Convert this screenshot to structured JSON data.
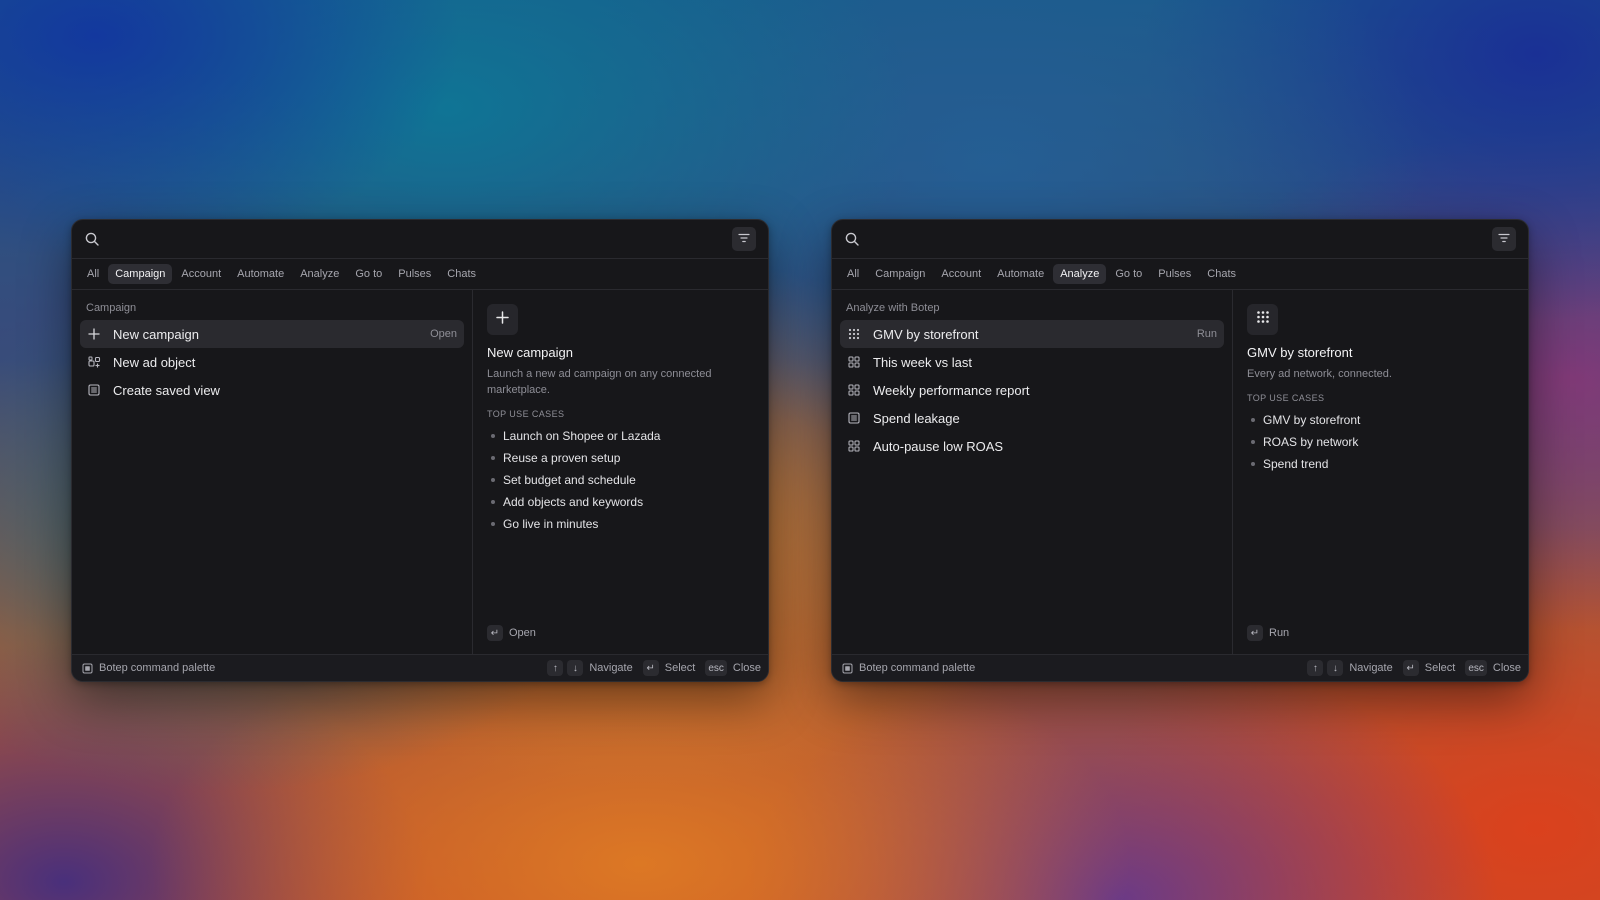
{
  "palettes": [
    {
      "search": {
        "placeholder": ""
      },
      "tabs": [
        "All",
        "Campaign",
        "Account",
        "Automate",
        "Analyze",
        "Go to",
        "Pulses",
        "Chats"
      ],
      "active_tab": "Campaign",
      "section_label": "Campaign",
      "items": [
        {
          "icon": "plus-icon",
          "label": "New campaign",
          "action": "Open"
        },
        {
          "icon": "ad-object-icon",
          "label": "New ad object",
          "action": ""
        },
        {
          "icon": "saved-view-icon",
          "label": "Create saved view",
          "action": ""
        }
      ],
      "detail": {
        "icon": "plus-icon",
        "title": "New campaign",
        "description": "Launch a new ad campaign on any connected marketplace.",
        "uses_label": "TOP USE CASES",
        "uses": [
          "Launch on Shopee or Lazada",
          "Reuse a proven setup",
          "Set budget and schedule",
          "Add objects and keywords",
          "Go live in minutes"
        ],
        "action_key": "↵",
        "action_label": "Open"
      },
      "footer": {
        "brand": "Botep command palette",
        "up_key": "↑",
        "down_key": "↓",
        "navigate": "Navigate",
        "select_key": "↵",
        "select": "Select",
        "close_key": "esc",
        "close": "Close"
      }
    },
    {
      "search": {
        "placeholder": ""
      },
      "tabs": [
        "All",
        "Campaign",
        "Account",
        "Automate",
        "Analyze",
        "Go to",
        "Pulses",
        "Chats"
      ],
      "active_tab": "Analyze",
      "section_label": "Analyze with Botep",
      "items": [
        {
          "icon": "grid-dots-icon",
          "label": "GMV by storefront",
          "action": "Run"
        },
        {
          "icon": "grid-squares-icon",
          "label": "This week vs last",
          "action": ""
        },
        {
          "icon": "grid-squares-icon",
          "label": "Weekly performance report",
          "action": ""
        },
        {
          "icon": "report-icon",
          "label": "Spend leakage",
          "action": ""
        },
        {
          "icon": "grid-squares-icon",
          "label": "Auto-pause low ROAS",
          "action": ""
        }
      ],
      "detail": {
        "icon": "grid-dots-icon",
        "title": "GMV by storefront",
        "description": "Every ad network, connected.",
        "uses_label": "TOP USE CASES",
        "uses": [
          "GMV by storefront",
          "ROAS by network",
          "Spend trend"
        ],
        "action_key": "↵",
        "action_label": "Run"
      },
      "footer": {
        "brand": "Botep command palette",
        "up_key": "↑",
        "down_key": "↓",
        "navigate": "Navigate",
        "select_key": "↵",
        "select": "Select",
        "close_key": "esc",
        "close": "Close"
      }
    }
  ],
  "colors": {
    "panel": "#17171a",
    "selected": "#2a2a2f",
    "text": "#ececee",
    "muted": "#8e8e96"
  }
}
